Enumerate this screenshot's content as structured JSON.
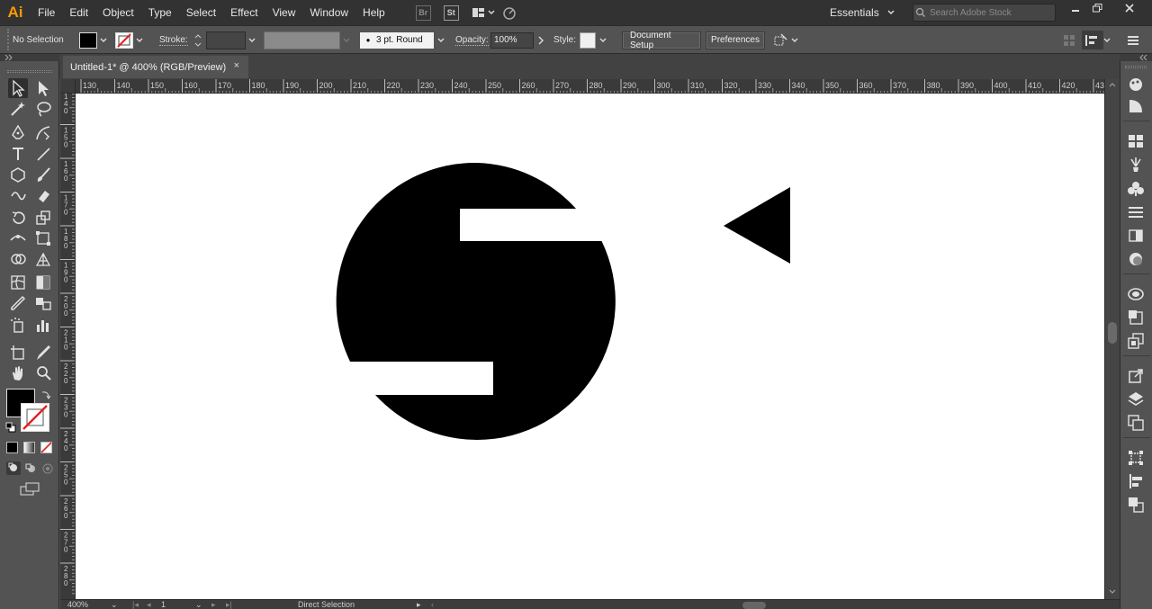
{
  "app": {
    "logo": "Ai"
  },
  "menu": [
    "File",
    "Edit",
    "Object",
    "Type",
    "Select",
    "Effect",
    "View",
    "Window",
    "Help"
  ],
  "menu_icons": {
    "bridge": "Br",
    "stock": "St"
  },
  "workspace": {
    "label": "Essentials"
  },
  "search": {
    "placeholder": "Search Adobe Stock"
  },
  "control_bar": {
    "selection_status": "No Selection",
    "stroke_label": "Stroke:",
    "brush_label": "3 pt. Round",
    "opacity_label": "Opacity:",
    "opacity_value": "100%",
    "style_label": "Style:",
    "document_setup": "Document Setup",
    "preferences": "Preferences"
  },
  "document": {
    "tab_title": "Untitled-1* @ 400% (RGB/Preview)",
    "close": "×"
  },
  "ruler_top": [
    "130",
    "140",
    "150",
    "160",
    "170",
    "180",
    "190",
    "200",
    "210",
    "220",
    "230",
    "240",
    "250",
    "260",
    "270",
    "280",
    "290",
    "300",
    "310",
    "320",
    "330",
    "340",
    "350",
    "360",
    "370",
    "380",
    "390",
    "400",
    "410",
    "420",
    "43"
  ],
  "ruler_left": [
    "140",
    "150",
    "160",
    "170",
    "180",
    "190",
    "200",
    "210",
    "220",
    "230",
    "240",
    "250",
    "260",
    "270",
    "280"
  ],
  "status_bar": {
    "zoom": "400%",
    "artboard_number": "1",
    "tool_name": "Direct Selection"
  },
  "colors": {
    "fill": "#000000",
    "canvas": "#ffffff",
    "ui_dark": "#323232",
    "ui_mid": "#535353",
    "logo": "#ff9a00"
  }
}
